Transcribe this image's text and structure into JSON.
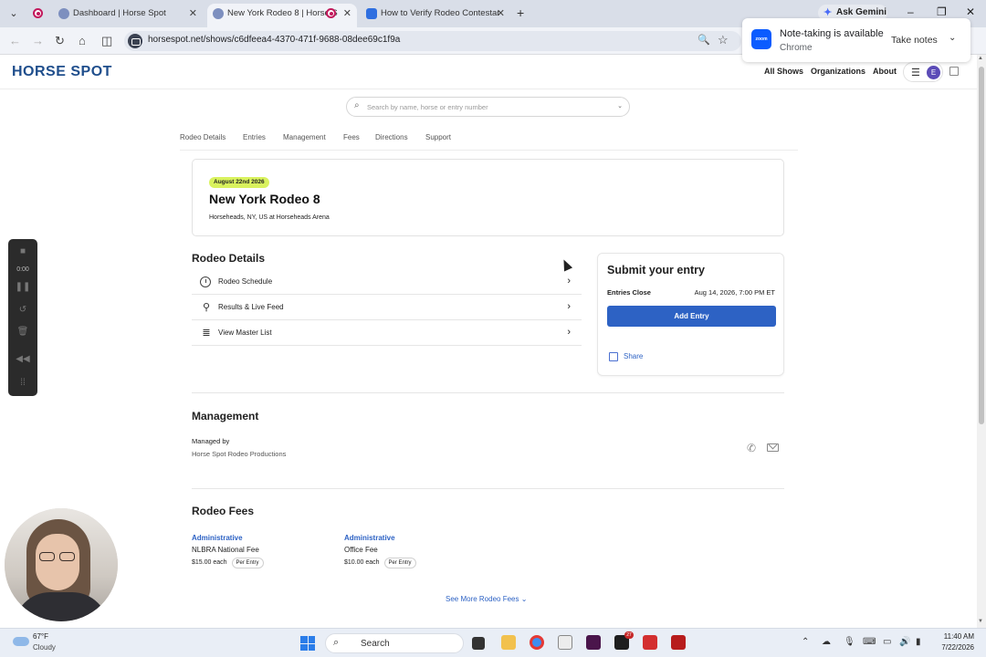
{
  "browser": {
    "tabs": [
      {
        "title": "Dashboard | Horse Spot"
      },
      {
        "title": "New York Rodeo 8 | Horse S"
      },
      {
        "title": "How to Verify Rodeo Contestar"
      }
    ],
    "gemini_label": "Ask Gemini",
    "url": "horsespot.net/shows/c6dfeea4-4370-471f-9688-08dee69c1f9a",
    "popup": {
      "title": "Note-taking is available",
      "subtitle": "Chrome",
      "button": "Take notes",
      "logo": "zoom"
    }
  },
  "site": {
    "logo": "HORSE SPOT",
    "nav": [
      "All Shows",
      "Organizations",
      "About"
    ],
    "avatar_initial": "E",
    "search_placeholder": "Search by name, horse or entry number",
    "subnav": [
      "Rodeo Details",
      "Entries",
      "Management",
      "Fees",
      "Directions",
      "Support"
    ]
  },
  "event": {
    "date_badge": "August 22nd 2026",
    "title": "New York Rodeo 8",
    "location": "Horseheads, NY, US at Horseheads Arena"
  },
  "details": {
    "heading": "Rodeo Details",
    "rows": [
      {
        "label": "Rodeo Schedule",
        "icon": "clock-icon"
      },
      {
        "label": "Results & Live Feed",
        "icon": "award-icon"
      },
      {
        "label": "View Master List",
        "icon": "list-icon"
      }
    ]
  },
  "submit": {
    "title": "Submit your entry",
    "close_label": "Entries Close",
    "close_value": "Aug 14, 2026, 7:00 PM ET",
    "button": "Add Entry",
    "share": "Share"
  },
  "management": {
    "heading": "Management",
    "label": "Managed by",
    "value": "Horse Spot Rodeo Productions"
  },
  "fees": {
    "heading": "Rodeo Fees",
    "items": [
      {
        "category": "Administrative",
        "name": "NLBRA National Fee",
        "price": "$15.00 each",
        "unit": "Per Entry"
      },
      {
        "category": "Administrative",
        "name": "Office Fee",
        "price": "$10.00 each",
        "unit": "Per Entry"
      }
    ],
    "see_more": "See More Rodeo Fees"
  },
  "recorder": {
    "time": "0:00"
  },
  "taskbar": {
    "weather_temp": "67°F",
    "weather_desc": "Cloudy",
    "search": "Search",
    "time": "11:40 AM",
    "date": "7/22/2026",
    "notification_count": "27"
  },
  "colors": {
    "brand": "#1f4e8c",
    "primary_button": "#2d62c4",
    "date_badge": "#d9f25e"
  }
}
